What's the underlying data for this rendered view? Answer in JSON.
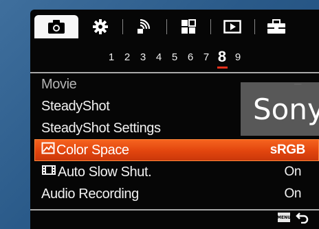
{
  "tabs": [
    {
      "icon": "camera-icon",
      "active": true
    },
    {
      "icon": "gear-icon",
      "active": false
    },
    {
      "icon": "wireless-icon",
      "active": false
    },
    {
      "icon": "grid-icon",
      "active": false
    },
    {
      "icon": "playback-icon",
      "active": false
    },
    {
      "icon": "toolbox-icon",
      "active": false
    }
  ],
  "pages": [
    "1",
    "2",
    "3",
    "4",
    "5",
    "6",
    "7",
    "8",
    "9"
  ],
  "current_page": "8",
  "menu": {
    "items": [
      {
        "label": "Movie",
        "value": "–"
      },
      {
        "label": "SteadyShot",
        "value": ""
      },
      {
        "label": "SteadyShot Settings",
        "value": ""
      },
      {
        "label": "Color Space",
        "value": "sRGB",
        "icon": "color-space-icon"
      },
      {
        "label": "Auto Slow Shut.",
        "value": "On",
        "icon": "film-icon"
      },
      {
        "label": "Audio Recording",
        "value": "On"
      }
    ]
  },
  "footer": {
    "menu_badge": "MENU",
    "back_icon": "back-arrow-icon"
  },
  "watermark": "Sony",
  "colors": {
    "highlight": "#e2450e",
    "accent_underline": "#e5301c"
  }
}
